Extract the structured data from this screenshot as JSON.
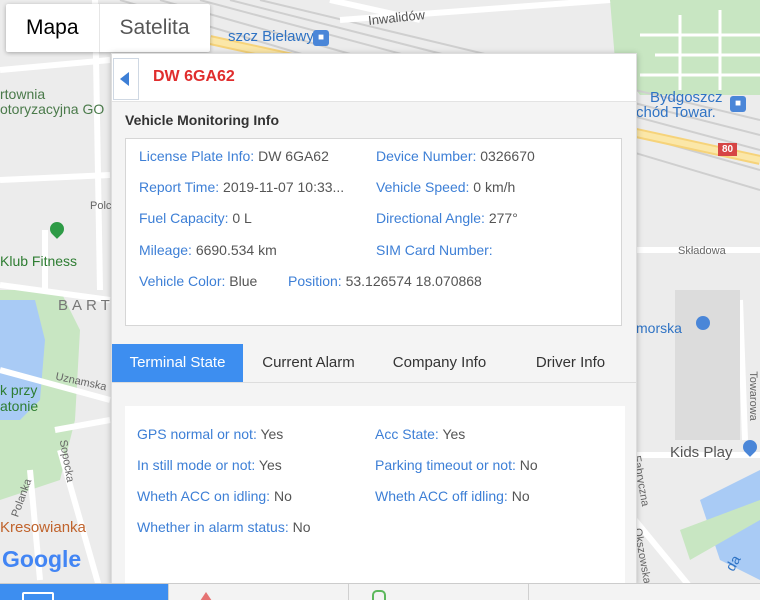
{
  "map": {
    "type_control": {
      "map_label": "Mapa",
      "satellite_label": "Satelita"
    },
    "labels": {
      "inwalidow": "Inwalidów",
      "bielawy": "szcz Bielawy",
      "bydgoszcz_1": "Bydgoszcz",
      "bydgoszcz_2": "chód Towar.",
      "road_number": "80",
      "kartownia_1": "rtownia",
      "kartownia_2": "otoryzacyjna GO",
      "polc": "Polc",
      "klub_fitness": "Klub Fitness",
      "barti": "BART",
      "skladowa": "Składowa",
      "pomorska": "morska",
      "uznamska": "Uznamska",
      "park_1": "k przy",
      "park_2": "atonie",
      "towarowa": "Towarowa",
      "sopocka": "Sopocka",
      "kids_play": "Kids Play",
      "fabryczna": "Fabryczna",
      "polanka": "Polanka",
      "kresowianka": "Kresowianka",
      "okszowska": "Okszowska",
      "google": "Google",
      "da": "da"
    }
  },
  "panel": {
    "plate_title": "DW 6GA62",
    "section_title": "Vehicle Monitoring Info",
    "info": {
      "license_plate": {
        "label": "License Plate Info:",
        "value": "DW 6GA62"
      },
      "device_number": {
        "label": "Device Number:",
        "value": "0326670"
      },
      "report_time": {
        "label": "Report Time:",
        "value": "2019-11-07 10:33..."
      },
      "vehicle_speed": {
        "label": "Vehicle Speed:",
        "value": "0 km/h"
      },
      "fuel_capacity": {
        "label": "Fuel Capacity:",
        "value": "0 L"
      },
      "directional_angle": {
        "label": "Directional Angle:",
        "value": "277°"
      },
      "mileage": {
        "label": "Mileage:",
        "value": "6690.534 km"
      },
      "sim_card": {
        "label": "SIM Card Number:",
        "value": ""
      },
      "vehicle_color": {
        "label": "Vehicle Color:",
        "value": "Blue"
      },
      "position": {
        "label": "Position:",
        "value": "53.126574 18.070868"
      }
    },
    "tabs": [
      "Terminal State",
      "Current Alarm",
      "Company Info",
      "Driver Info"
    ],
    "active_tab": "Terminal State",
    "state": {
      "gps": {
        "label": "GPS normal or not:",
        "value": "Yes"
      },
      "acc": {
        "label": "Acc State:",
        "value": "Yes"
      },
      "still": {
        "label": "In still mode or not:",
        "value": "Yes"
      },
      "parking": {
        "label": "Parking timeout or not:",
        "value": "No"
      },
      "acc_on_idling": {
        "label": "Wheth ACC on idling:",
        "value": "No"
      },
      "acc_off_idling": {
        "label": "Wheth ACC off idling:",
        "value": "No"
      },
      "alarm_status": {
        "label": "Whether in alarm status:",
        "value": "No"
      }
    }
  },
  "colors": {
    "accent": "#3d8ef0",
    "plate_red": "#e02d2d",
    "label_blue": "#3d7fd6",
    "value_gray": "#555555"
  }
}
